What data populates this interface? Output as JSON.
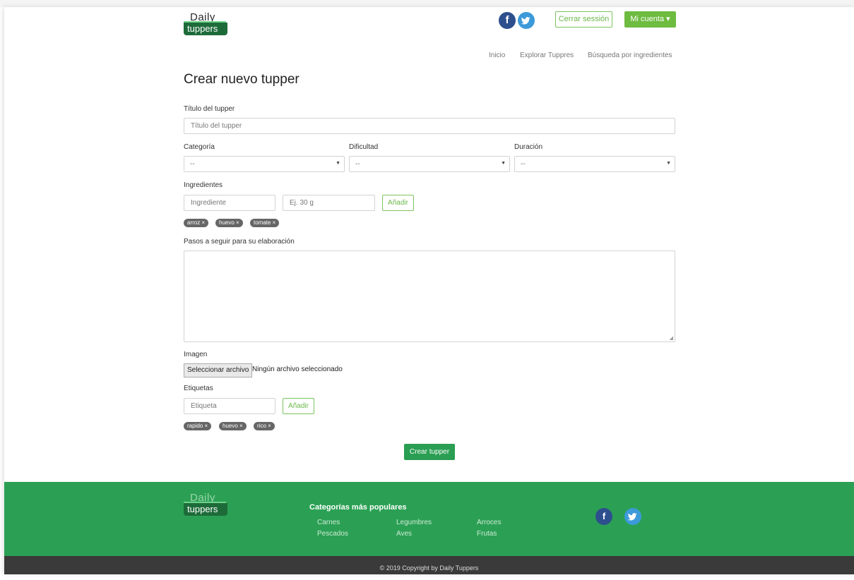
{
  "header": {
    "logo_top": "Daily",
    "logo_bottom": "tuppers",
    "facebook_glyph": "f",
    "twitter_glyph": "t",
    "logout_label": "Cerrar sessión",
    "account_label": "Mi cuenta ▾"
  },
  "nav": {
    "items": [
      "Inicio",
      "Explorar Tuppres",
      "Búsqueda por ingredientes"
    ]
  },
  "page_title": "Crear nuevo tupper",
  "form": {
    "title_label": "Título del tupper",
    "title_placeholder": "Título del tupper",
    "category_label": "Categoría",
    "difficulty_label": "Dificultad",
    "duration_label": "Duración",
    "select_default": "--",
    "ingredients_label": "Ingredientes",
    "ingredient_placeholder": "Ingrediente",
    "quantity_placeholder": "Ej. 30 g",
    "add_label": "Añadir",
    "ingredient_chips": [
      "arroz ×",
      "huevo ×",
      "tomate ×"
    ],
    "steps_label": "Pasos a seguir para su elaboración",
    "image_label": "Imagen",
    "file_button": "Seleccionar archivo",
    "file_status": "Ningún archivo seleccionado",
    "tags_label": "Etiquetas",
    "tag_placeholder": "Etiqueta",
    "tag_chips": [
      "rapido ×",
      "huevo ×",
      "rico ×"
    ],
    "submit_label": "Crear tupper"
  },
  "footer": {
    "logo_top": "Daily",
    "logo_bottom": "tuppers",
    "popular_title": "Categorías más populares",
    "categories": [
      "Carnes",
      "Legumbres",
      "Arroces",
      "Pescados",
      "Aves",
      "Frutas"
    ],
    "copyright": "© 2019 Copyright by Daily Tuppers"
  },
  "colors": {
    "brand_green": "#2ba054",
    "accent_green": "#6dbb3f",
    "dark_footer": "#3a3a3a"
  }
}
